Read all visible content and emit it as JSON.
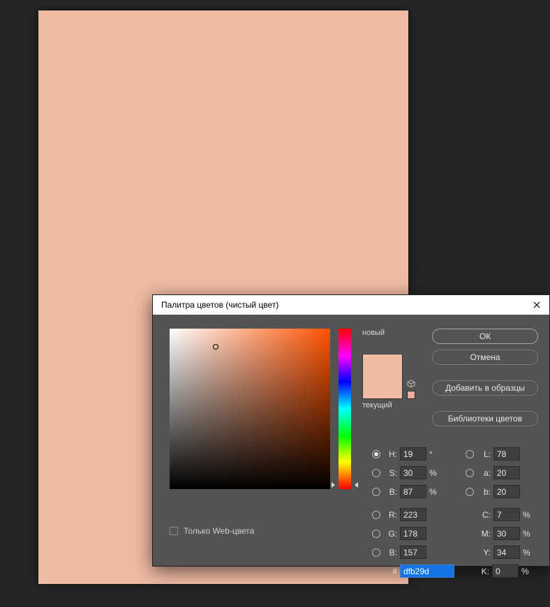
{
  "canvas": {
    "color": "#efbba4"
  },
  "dialog": {
    "title": "Палитра цветов (чистый цвет)",
    "preview_new_label": "новый",
    "preview_current_label": "текущий",
    "buttons": {
      "ok": "ОК",
      "cancel": "Отмена",
      "add_swatch": "Добавить в образцы",
      "libraries": "Библиотеки цветов"
    },
    "webonly_label": "Только Web-цвета",
    "hex_prefix": "#",
    "hex_value": "dfb29d",
    "fields": {
      "H": {
        "label": "H:",
        "value": "19",
        "unit": "°",
        "selected": true
      },
      "S": {
        "label": "S:",
        "value": "30",
        "unit": "%",
        "selected": false
      },
      "Bv": {
        "label": "B:",
        "value": "87",
        "unit": "%",
        "selected": false
      },
      "R": {
        "label": "R:",
        "value": "223",
        "unit": "",
        "selected": false
      },
      "G": {
        "label": "G:",
        "value": "178",
        "unit": "",
        "selected": false
      },
      "Bb": {
        "label": "B:",
        "value": "157",
        "unit": "",
        "selected": false
      },
      "L": {
        "label": "L:",
        "value": "78",
        "unit": "",
        "selected": false
      },
      "a": {
        "label": "a:",
        "value": "20",
        "unit": "",
        "selected": false
      },
      "b": {
        "label": "b:",
        "value": "20",
        "unit": "",
        "selected": false
      },
      "C": {
        "label": "C:",
        "value": "7",
        "unit": "%"
      },
      "M": {
        "label": "M:",
        "value": "30",
        "unit": "%"
      },
      "Y": {
        "label": "Y:",
        "value": "34",
        "unit": "%"
      },
      "K": {
        "label": "K:",
        "value": "0",
        "unit": "%"
      }
    },
    "new_color": "#efbba4",
    "current_color": "#efbba4"
  }
}
